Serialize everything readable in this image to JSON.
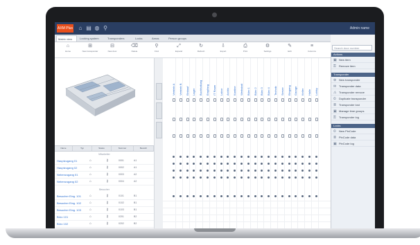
{
  "app": {
    "logo_text": "AXM Plus",
    "title_icons": [
      "home-icon",
      "document-icon",
      "globe-icon",
      "search-icon"
    ],
    "user_label": "Admin name"
  },
  "tabs": [
    {
      "label": "Matrix view",
      "active": true
    },
    {
      "label": "Locking system"
    },
    {
      "label": "Transponders"
    },
    {
      "label": "Locks"
    },
    {
      "label": "Areas"
    },
    {
      "label": "Person groups"
    }
  ],
  "toolbar": [
    {
      "icon": "⌂",
      "label": "Home"
    },
    {
      "icon": "⊞",
      "label": "New transponder"
    },
    {
      "icon": "⊟",
      "label": "New door"
    },
    {
      "icon": "⌫",
      "label": "Delete"
    },
    {
      "icon": "⚲",
      "label": "Find"
    },
    {
      "icon": "⤢",
      "label": "Expand"
    },
    {
      "icon": "↻",
      "label": "Refresh"
    },
    {
      "icon": "⇩",
      "label": "Export"
    },
    {
      "icon": "⎙",
      "label": "Print"
    },
    {
      "icon": "⚙",
      "label": "Settings"
    },
    {
      "icon": "✎",
      "label": "Edit"
    },
    {
      "icon": "≡",
      "label": "Columns"
    }
  ],
  "search": {
    "placeholder": "Search door number"
  },
  "sidepanel": {
    "sections": [
      {
        "header": "Actions",
        "items": [
          "New item",
          "Remove item"
        ]
      },
      {
        "header": "Transponder",
        "items": [
          "New transponder",
          "Transponder data",
          "Transponder remove",
          "Duplicate transponder",
          "Transponder lost",
          "Manage time groups",
          "Transponder log"
        ]
      },
      {
        "header": "Locks",
        "items": [
          "New PinCode",
          "PinCode data",
          "PinCode log"
        ]
      }
    ]
  },
  "columns": [
    "Vertrieb A",
    "Vertrieb B",
    "Einkauf",
    "Lager",
    "Buchhaltung",
    "Empfang",
    "IT Raum",
    "Labor",
    "Archiv",
    "Kantine",
    "Werkstatt",
    "Büro 1",
    "Büro 2",
    "Büro 3",
    "Büro 4",
    "Technik",
    "Server",
    "Eingang",
    "Garage",
    "Keller",
    "Halle",
    "Lobby"
  ],
  "table": {
    "headers": [
      "Name",
      "Typ",
      "Status",
      "Nummer",
      "Bereich"
    ],
    "group1_label": "Mitarbeiter",
    "group1_rows": [
      {
        "name": "Hauptzugang 01",
        "num": "0001",
        "area": "A1"
      },
      {
        "name": "Hauptzugang 02",
        "num": "0002",
        "area": "A1"
      },
      {
        "name": "Nebenzugang 01",
        "num": "0003",
        "area": "A2"
      },
      {
        "name": "Nebenzugang 02",
        "num": "0004",
        "area": "A2"
      }
    ],
    "group2_label": "Besucher",
    "group2_rows": [
      {
        "name": "Besucher Eing. 101",
        "num": "0101",
        "area": "B1"
      },
      {
        "name": "Besucher Eing. 102",
        "num": "0102",
        "area": "B1"
      },
      {
        "name": "Besucher Eing. 103",
        "num": "0103",
        "area": "B1"
      },
      {
        "name": "Büro 101",
        "num": "0201",
        "area": "B2"
      },
      {
        "name": "Büro 102",
        "num": "0202",
        "area": "B2"
      },
      {
        "name": "Büro 103",
        "num": "0203",
        "area": "B2"
      },
      {
        "name": "Büro 104",
        "num": "0204",
        "area": "B2"
      },
      {
        "name": "Büro 105",
        "num": "0205",
        "area": "B2"
      }
    ]
  },
  "colors": {
    "titlebar": "#2a3e62",
    "accent": "#e84e1b",
    "link": "#2c6fd1"
  }
}
